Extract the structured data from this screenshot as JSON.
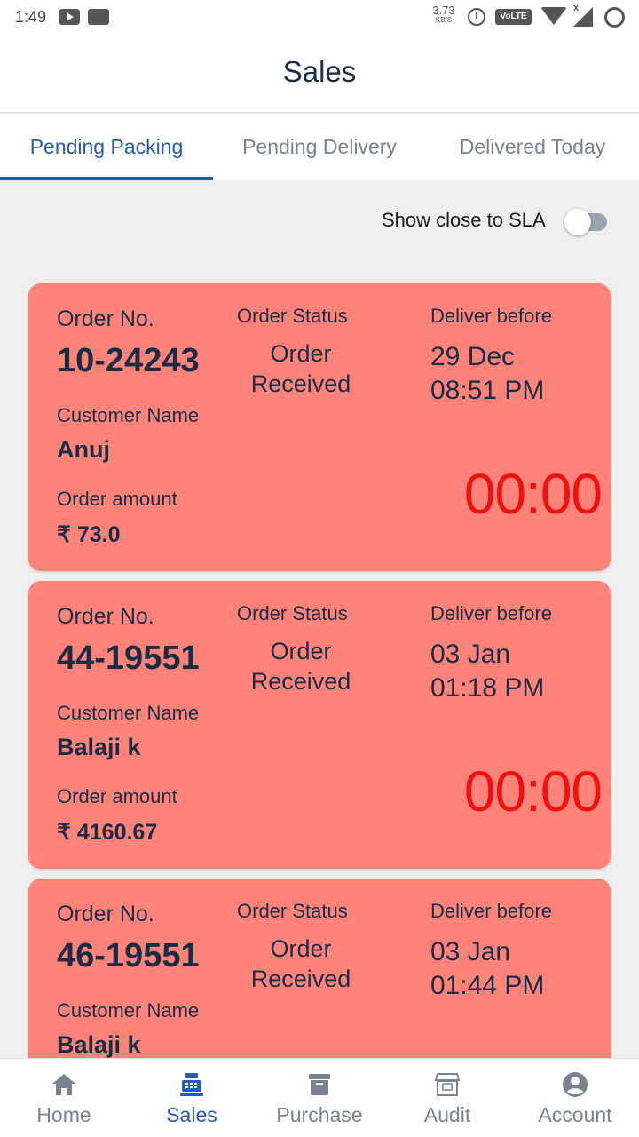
{
  "status_bar": {
    "time": "1:49",
    "net_speed": "3.73",
    "net_unit": "KB/S",
    "volte": "VoLTE",
    "x_mark": "x"
  },
  "header": {
    "title": "Sales"
  },
  "tabs": [
    {
      "label": "Pending Packing",
      "active": true
    },
    {
      "label": "Pending Delivery",
      "active": false
    },
    {
      "label": "Delivered Today",
      "active": false
    }
  ],
  "sla_toggle": {
    "label": "Show close to SLA",
    "on": false
  },
  "labels": {
    "order_no": "Order No.",
    "order_status": "Order Status",
    "deliver_before": "Deliver before",
    "customer_name": "Customer Name",
    "order_amount": "Order amount"
  },
  "orders": [
    {
      "order_no": "10-24243",
      "status": "Order Received",
      "deliver_date": "29 Dec",
      "deliver_time": "08:51 PM",
      "customer": "Anuj",
      "amount": "₹ 73.0",
      "timer": "00:00"
    },
    {
      "order_no": "44-19551",
      "status": "Order Received",
      "deliver_date": "03 Jan",
      "deliver_time": "01:18 PM",
      "customer": "Balaji k",
      "amount": "₹ 4160.67",
      "timer": "00:00"
    },
    {
      "order_no": "46-19551",
      "status": "Order Received",
      "deliver_date": "03 Jan",
      "deliver_time": "01:44 PM",
      "customer": "Balaji k",
      "amount": "",
      "timer": ""
    }
  ],
  "bottom_nav": [
    {
      "label": "Home",
      "icon": "home-icon",
      "active": false
    },
    {
      "label": "Sales",
      "icon": "cash-register-icon",
      "active": true
    },
    {
      "label": "Purchase",
      "icon": "archive-box-icon",
      "active": false
    },
    {
      "label": "Audit",
      "icon": "store-24-icon",
      "active": false
    },
    {
      "label": "Account",
      "icon": "account-circle-icon",
      "active": false
    }
  ],
  "colors": {
    "accent": "#2a5cad",
    "card_bg": "#ff8379",
    "timer": "#ee1111",
    "text_dark": "#1a2b44",
    "inactive": "#7a8290"
  }
}
